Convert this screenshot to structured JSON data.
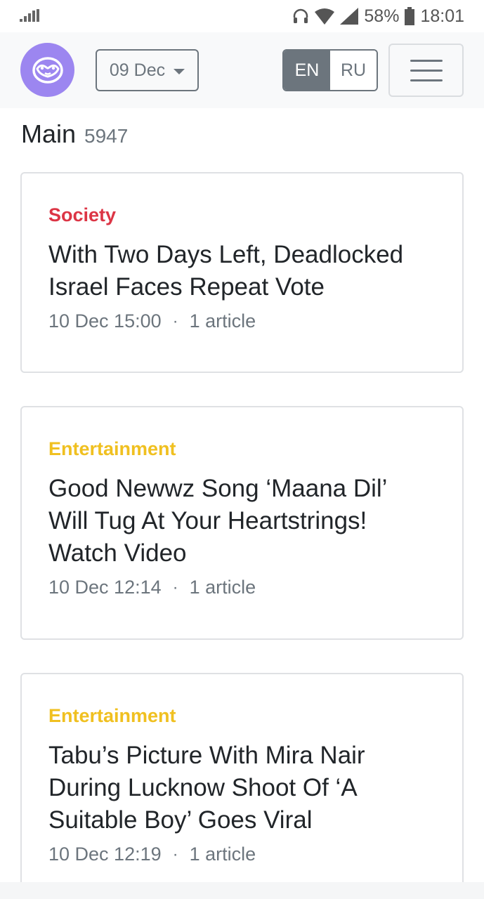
{
  "status_bar": {
    "battery_percent": "58%",
    "time": "18:01",
    "icons": [
      "signal-bars-icon",
      "headphones-icon",
      "wifi-icon",
      "cell-signal-icon",
      "battery-icon"
    ]
  },
  "navbar": {
    "logo_icon": "sloth-logo-icon",
    "date_selector": "09 Dec",
    "languages": [
      {
        "label": "EN",
        "active": true
      },
      {
        "label": "RU",
        "active": false
      }
    ],
    "menu_icon": "hamburger-menu-icon"
  },
  "page": {
    "title": "Main",
    "count": "5947"
  },
  "stories": [
    {
      "category": "Society",
      "category_color": "#dc3545",
      "title_lines": [
        "With Two Days Left, Deadlocked",
        "Israel Faces Repeat Vote"
      ],
      "time": "10 Dec 15:00",
      "articles": "1 article"
    },
    {
      "category": "Entertainment",
      "category_color": "#f0c020",
      "title_lines": [
        "Good Newwz Song ‘Maana Dil’",
        "Will Tug At Your Heartstrings!",
        "Watch Video"
      ],
      "time": "10 Dec 12:14",
      "articles": "1 article"
    },
    {
      "category": "Entertainment",
      "category_color": "#f0c020",
      "title_lines": [
        "Tabu’s Picture With Mira Nair",
        "During Lucknow Shoot Of ‘A",
        "Suitable Boy’ Goes Viral"
      ],
      "time": "10 Dec 12:19",
      "articles": "1 article"
    }
  ],
  "meta_separator": "·"
}
